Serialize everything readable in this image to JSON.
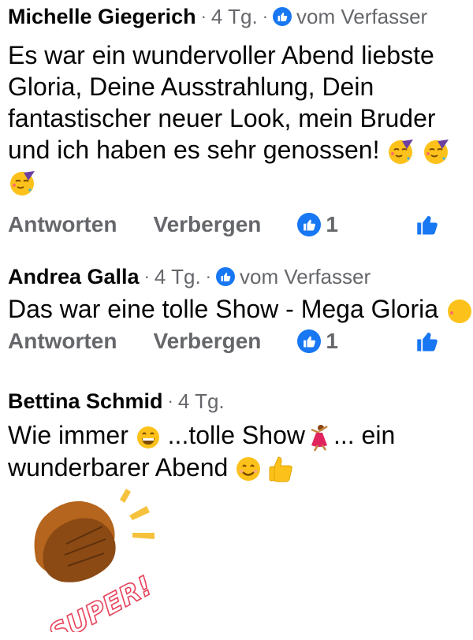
{
  "comments": [
    {
      "author": "Michelle Giegerich",
      "age": "4 Tg.",
      "badge": "vom Verfasser",
      "text_before_emoji": "Es war ein wundervoller Abend liebste Gloria, Deine Ausstrahlung, Dein fantastischer neuer Look, mein Bruder und ich haben es sehr genossen!",
      "reply_label": "Antworten",
      "hide_label": "Verbergen",
      "like_count": "1"
    },
    {
      "author": "Andrea Galla",
      "age": "4 Tg.",
      "badge": "vom Verfasser",
      "text_before_emoji": "Das war eine tolle Show - Mega Gloria",
      "reply_label": "Antworten",
      "hide_label": "Verbergen",
      "like_count": "1"
    },
    {
      "author": "Bettina Schmid",
      "age": "4 Tg.",
      "text_part1": "Wie immer",
      "text_part2": "...tolle Show",
      "text_part3": "...  ein",
      "text_part4": "wunderbarer Abend",
      "sticker_text": "SUPER!"
    }
  ],
  "colors": {
    "facebook_blue": "#1877f2",
    "secondary_text": "#65676b",
    "sticker_hand": "#b5651d",
    "sticker_text": "#e8425a",
    "sticker_rays": "#f6c23e"
  },
  "icons": [
    "like-badge-icon",
    "party-face-icon",
    "grinning-face-icon",
    "dancer-icon",
    "smiling-face-icon",
    "thumbs-up-icon",
    "clapping-hands-sticker"
  ]
}
